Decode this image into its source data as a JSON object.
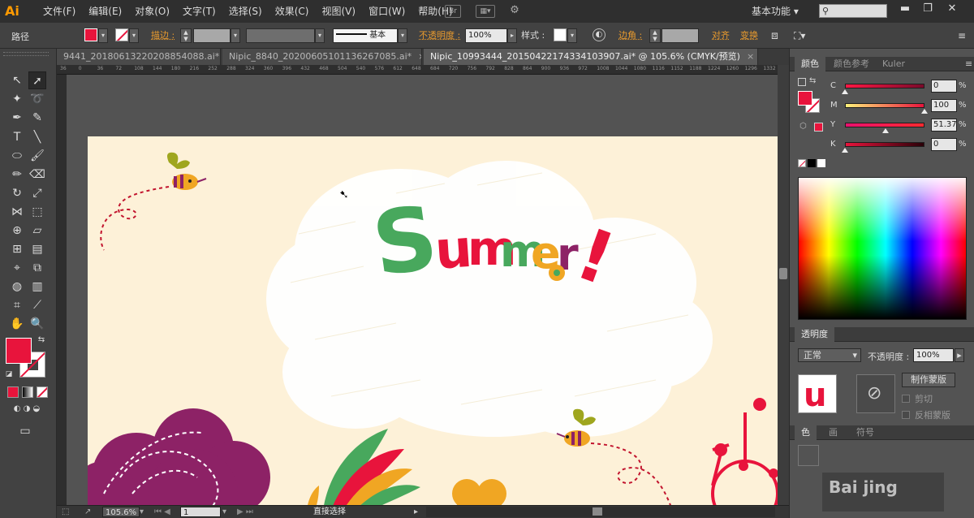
{
  "app": {
    "logo": "Ai"
  },
  "menu": [
    "文件(F)",
    "编辑(E)",
    "对象(O)",
    "文字(T)",
    "选择(S)",
    "效果(C)",
    "视图(V)",
    "窗口(W)",
    "帮助(H)"
  ],
  "menubar_icons": {
    "br": "Br"
  },
  "workspace": "基本功能",
  "control_bar": {
    "selection_label": "路径",
    "stroke_link": "描边 :",
    "stroke_style": "基本",
    "opacity_link": "不透明度 :",
    "opacity_value": "100%",
    "style_label": "样式 :",
    "corner_link": "边角 :",
    "align_link": "对齐",
    "transform_link": "变换"
  },
  "tabs": [
    {
      "label": "9441_20180613220208854088.ai*",
      "close": "×",
      "active": false
    },
    {
      "label": "Nipic_8840_20200605101136267085.ai*",
      "close": "×",
      "active": false
    },
    {
      "label": "Nipic_10993444_20150422174334103907.ai* @ 105.6% (CMYK/预览)",
      "close": "×",
      "active": true
    }
  ],
  "ruler_ticks": [
    "36",
    "0",
    "36",
    "72",
    "108",
    "144",
    "180",
    "216",
    "252",
    "288",
    "324",
    "360",
    "396",
    "432",
    "468",
    "504",
    "540",
    "576",
    "612",
    "648",
    "684",
    "720",
    "756",
    "792",
    "828",
    "864",
    "900",
    "936",
    "972",
    "1008",
    "1044",
    "1080",
    "1116",
    "1152",
    "1188",
    "1224",
    "1260",
    "1296",
    "1332",
    "1368"
  ],
  "artboard": {
    "headline": "Summer!"
  },
  "status": {
    "zoom": "105.6%",
    "page": "1",
    "tool_name": "直接选择"
  },
  "panels": {
    "color": {
      "tabs": [
        "颜色",
        "颜色参考",
        "Kuler"
      ],
      "sliders": [
        {
          "label": "C",
          "value": "0",
          "unit": "%",
          "level": 0.0,
          "gradient": "linear-gradient(to right,#ff1744,#7a0a2a)"
        },
        {
          "label": "M",
          "value": "100",
          "unit": "%",
          "level": 1.0,
          "gradient": "linear-gradient(to right,#fff27a,#e8143c)"
        },
        {
          "label": "Y",
          "value": "51.37",
          "unit": "%",
          "level": 0.51,
          "gradient": "linear-gradient(to right,#e8106e,#ff2a30)"
        },
        {
          "label": "K",
          "value": "0",
          "unit": "%",
          "level": 0.0,
          "gradient": "linear-gradient(to right,#e8143c,#2a0008)"
        }
      ]
    },
    "transparency": {
      "tab": "透明度",
      "blend_mode": "正常",
      "opacity_label": "不透明度 :",
      "opacity_value": "100%",
      "make_mask_button": "制作蒙版",
      "clip_label": "剪切",
      "invert_label": "反相蒙版"
    },
    "bottom_tabs": [
      "色",
      "画",
      "符号"
    ],
    "watermark": "Bai jing"
  },
  "colors": {
    "fill": "#e8143c",
    "accent_orange": "#e89a2e",
    "artboard": "#fdf1d8"
  }
}
